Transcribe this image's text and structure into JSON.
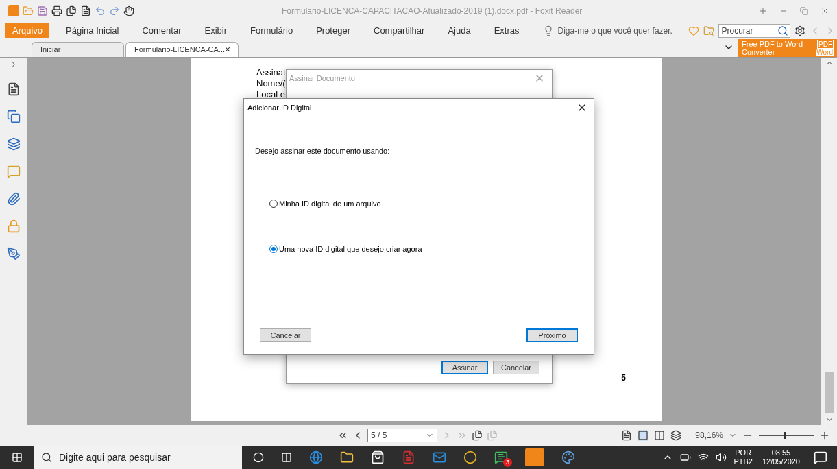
{
  "window": {
    "title": "Formulario-LICENCA-CAPACITACAO-Atualizado-2019 (1).docx.pdf - Foxit Reader"
  },
  "menu": [
    {
      "label": "Arquivo",
      "selected": true
    },
    {
      "label": "Página Inicial",
      "selected": false
    },
    {
      "label": "Comentar",
      "selected": false
    },
    {
      "label": "Exibir",
      "selected": false
    },
    {
      "label": "Formulário",
      "selected": false
    },
    {
      "label": "Proteger",
      "selected": false
    },
    {
      "label": "Compartilhar",
      "selected": false
    },
    {
      "label": "Ajuda",
      "selected": false
    },
    {
      "label": "Extras",
      "selected": false
    }
  ],
  "tell_me": {
    "placeholder": "Diga-me o que você quer fazer."
  },
  "search": {
    "placeholder": "Procurar"
  },
  "doc_tabs": [
    {
      "label": "Iniciar",
      "selected": false,
      "closable": false
    },
    {
      "label": "Formulario-LICENCA-CA...",
      "selected": true,
      "closable": true
    }
  ],
  "close_glyph": "×",
  "ad": {
    "line_1": "Free PDF to Word",
    "line_2": "Converter",
    "badge_1": "PDF",
    "badge_2": "Word"
  },
  "document": {
    "lines": [
      "Assinat",
      "Nome/(",
      "Local e"
    ],
    "page_number": "5"
  },
  "back_dialog": {
    "title": "Assinar Documento",
    "buttons": [
      {
        "label": "Assinar",
        "default": true
      },
      {
        "label": "Cancelar",
        "default": false
      }
    ]
  },
  "dialog": {
    "title": "Adicionar ID Digital",
    "prompt": "Desejo assinar este documento usando:",
    "options": [
      {
        "label": "Minha ID digital de um arquivo",
        "selected": false
      },
      {
        "label": "Uma nova ID digital que desejo criar agora",
        "selected": true
      }
    ],
    "buttons": [
      {
        "label": "Cancelar",
        "default": false
      },
      {
        "label": "Próximo",
        "default": true
      }
    ]
  },
  "status_bar": {
    "page": "5 / 5",
    "zoom": "98,16%",
    "zoom_slider": {
      "level": 0.45
    }
  },
  "taskbar": {
    "search_placeholder": "Digite aqui para pesquisar",
    "badge": "3",
    "language": "POR",
    "layout": "PTB2",
    "time": "08:55",
    "date": "12/05/2020"
  }
}
